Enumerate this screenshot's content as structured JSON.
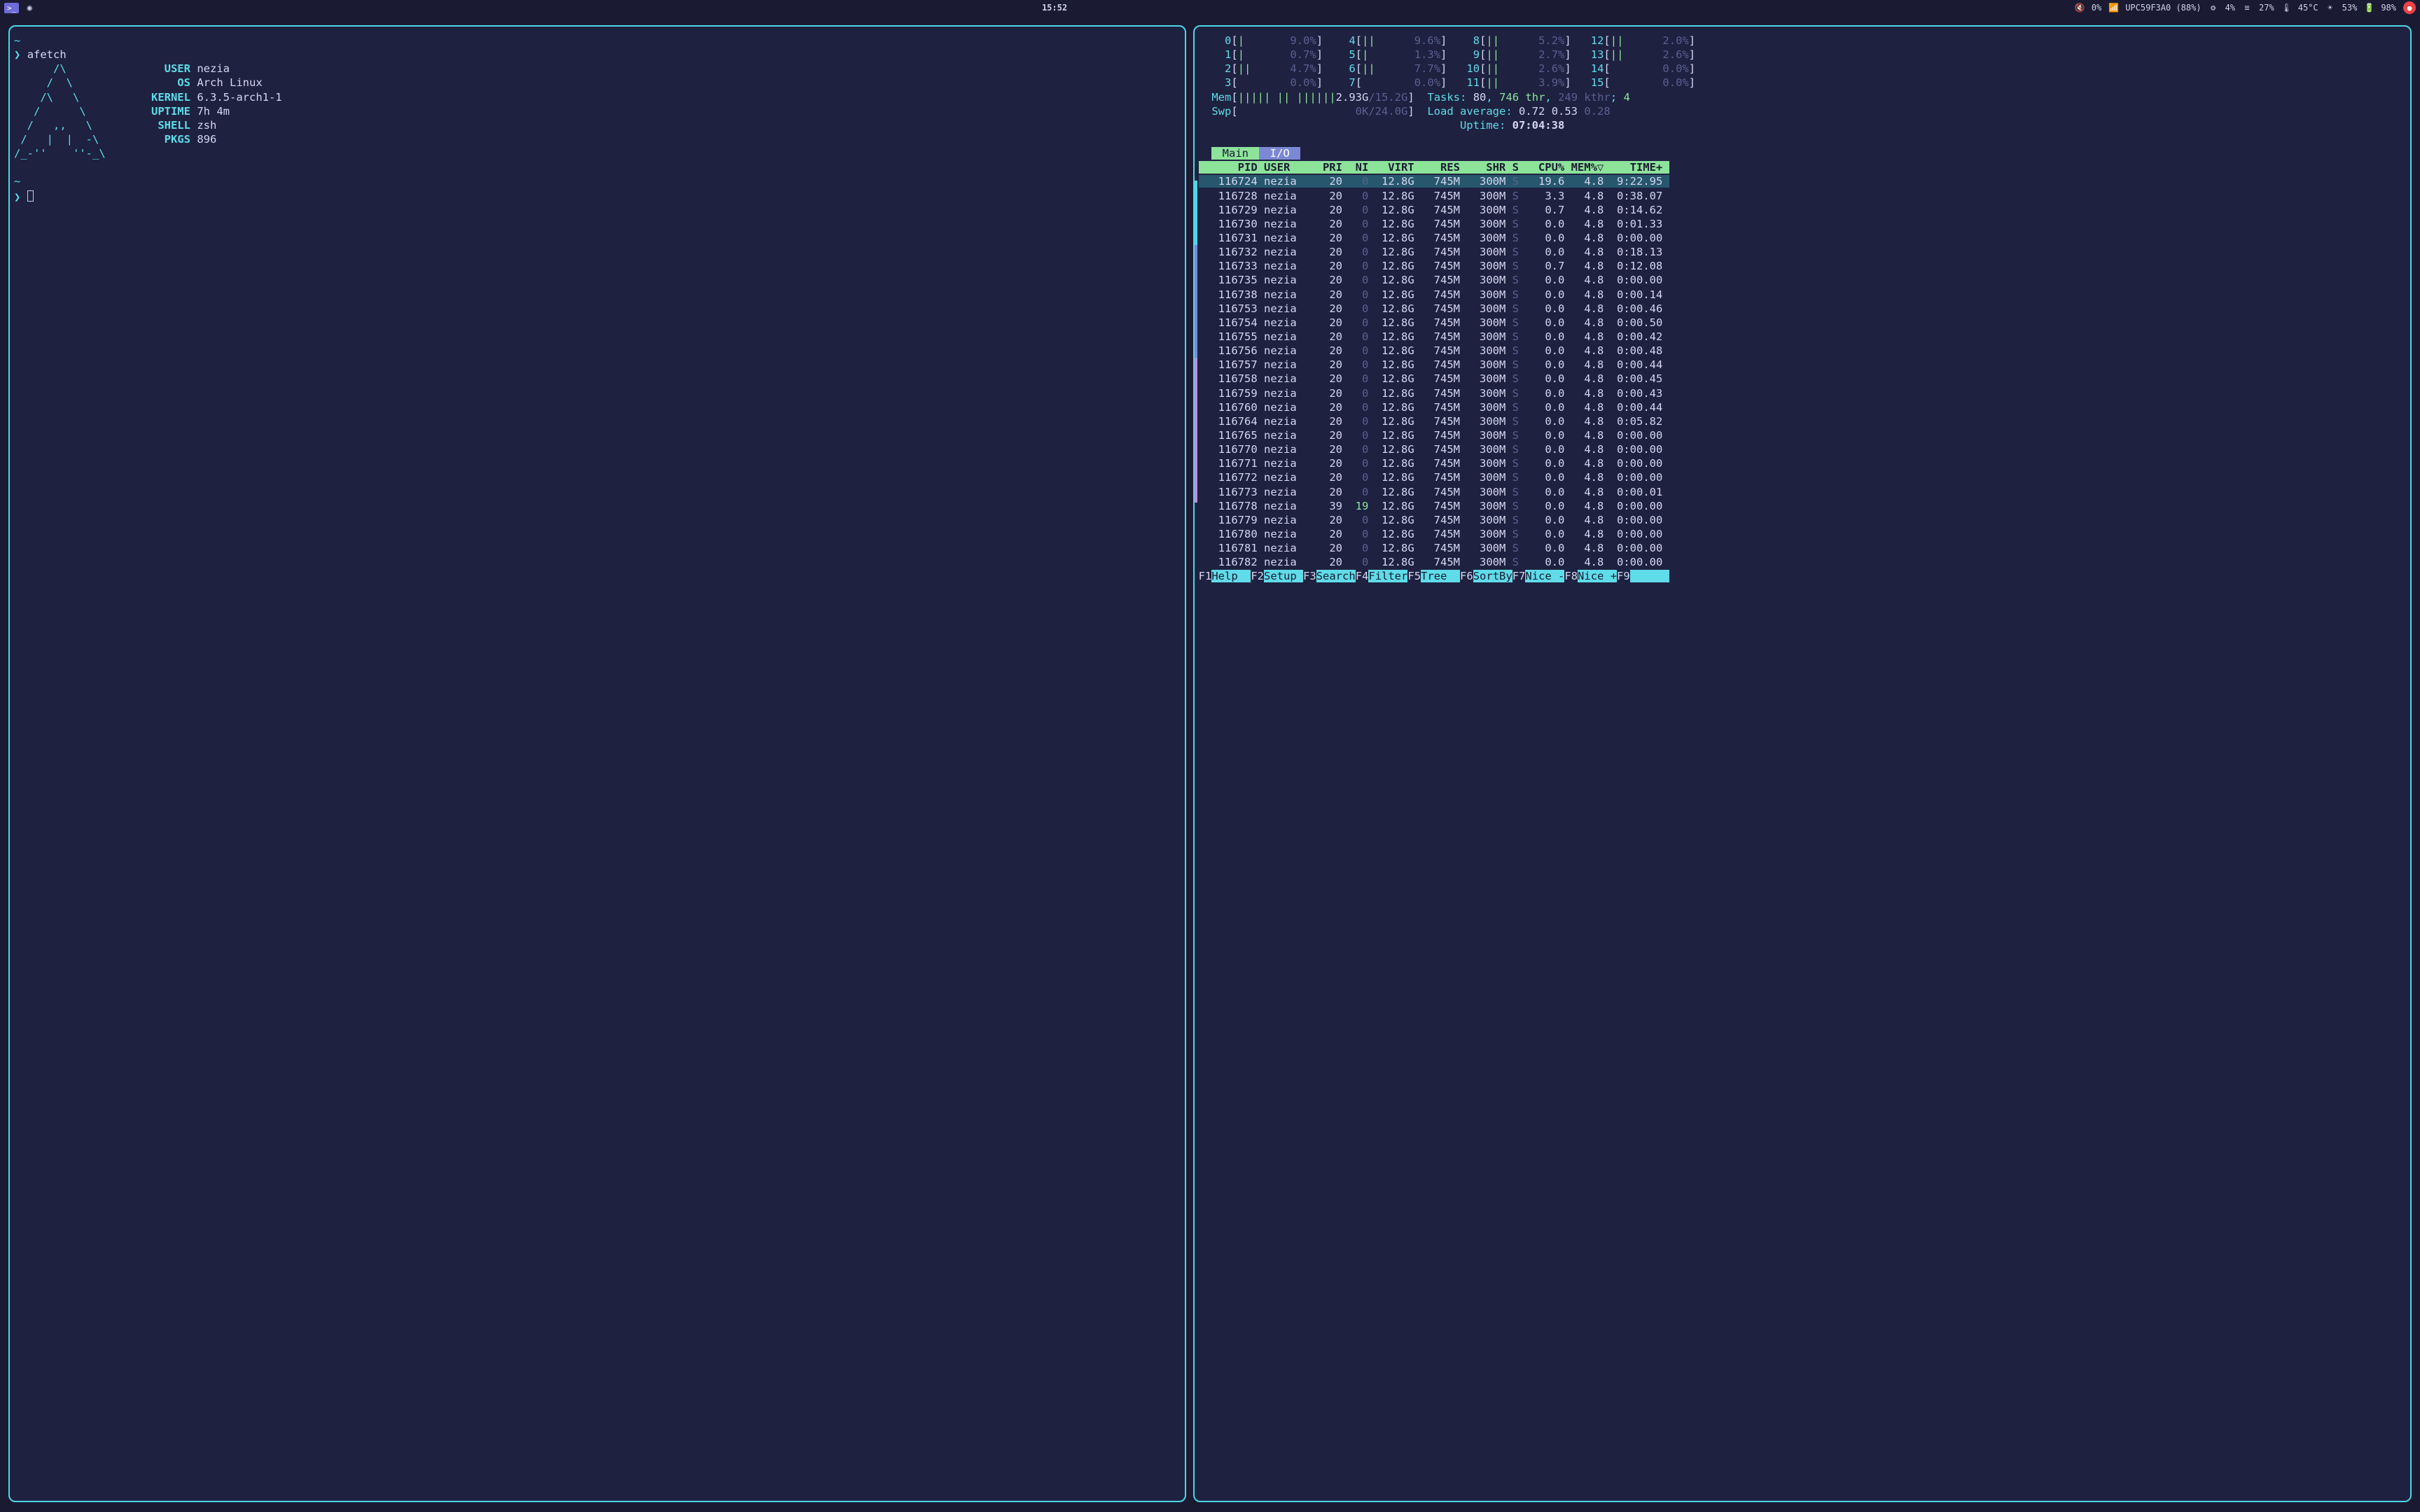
{
  "topbar": {
    "time": "15:52",
    "vol_pct": "0%",
    "wifi": "UPC59F3A0 (88%)",
    "gear_pct": "4%",
    "lines_pct": "27%",
    "temp": "45°C",
    "sun_pct": "53%",
    "bat_pct": "98%"
  },
  "afetch": {
    "prompt_cmd": "afetch",
    "ascii": [
      "      /\\",
      "     /  \\",
      "    /\\   \\",
      "   /      \\",
      "  /   ,,   \\",
      " /   |  |  -\\",
      "/_-''    ''-_\\"
    ],
    "labels": {
      "user": "USER",
      "os": "OS",
      "kernel": "KERNEL",
      "uptime": "UPTIME",
      "shell": "SHELL",
      "pkgs": "PKGS"
    },
    "vals": {
      "user": "nezia",
      "os": "Arch Linux",
      "kernel": "6.3.5-arch1-1",
      "uptime": "7h 4m",
      "shell": "zsh",
      "pkgs": "896"
    }
  },
  "htop": {
    "cpus": [
      {
        "n": "0",
        "bar": "|",
        "pct": "9.0%"
      },
      {
        "n": "1",
        "bar": "|",
        "pct": "0.7%"
      },
      {
        "n": "2",
        "bar": "||",
        "pct": "4.7%"
      },
      {
        "n": "3",
        "bar": "",
        "pct": "0.0%"
      },
      {
        "n": "4",
        "bar": "||",
        "pct": "9.6%"
      },
      {
        "n": "5",
        "bar": "|",
        "pct": "1.3%"
      },
      {
        "n": "6",
        "bar": "||",
        "pct": "7.7%"
      },
      {
        "n": "7",
        "bar": "",
        "pct": "0.0%"
      },
      {
        "n": "8",
        "bar": "||",
        "pct": "5.2%"
      },
      {
        "n": "9",
        "bar": "||",
        "pct": "2.7%"
      },
      {
        "n": "10",
        "bar": "||",
        "pct": "2.6%"
      },
      {
        "n": "11",
        "bar": "||",
        "pct": "3.9%"
      },
      {
        "n": "12",
        "bar": "||",
        "pct": "2.0%"
      },
      {
        "n": "13",
        "bar": "||",
        "pct": "2.6%"
      },
      {
        "n": "14",
        "bar": "",
        "pct": "0.0%"
      },
      {
        "n": "15",
        "bar": "",
        "pct": "0.0%"
      }
    ],
    "mem_label": "Mem",
    "mem_bar": "||||| || ||||||",
    "mem_used": "2.93G",
    "mem_total": "15.2G",
    "swp_label": "Swp",
    "swp_used": "0K",
    "swp_total": "24.0G",
    "tasks_label": "Tasks:",
    "tasks_procs": "80",
    "tasks_thr": "746",
    "tasks_thr_lbl": "thr",
    "tasks_kthr": "249",
    "tasks_kthr_lbl": "kthr",
    "tasks_running": "4",
    "load_label": "Load average:",
    "load": [
      "0.72",
      "0.53",
      "0.28"
    ],
    "uptime_label": "Uptime:",
    "uptime": "07:04:38",
    "tab_main": "Main",
    "tab_io": "I/O",
    "cols": [
      "PID",
      "USER",
      "PRI",
      "NI",
      "VIRT",
      "RES",
      "SHR",
      "S",
      "CPU%",
      "MEM%▽",
      "TIME+"
    ],
    "rows": [
      {
        "pid": "116724",
        "user": "nezia",
        "pri": "20",
        "ni": "0",
        "virt": "12.8G",
        "res": "745M",
        "shr": "300M",
        "s": "S",
        "cpu": "19.6",
        "mem": "4.8",
        "time": "9:22.95",
        "sel": true
      },
      {
        "pid": "116728",
        "user": "nezia",
        "pri": "20",
        "ni": "0",
        "virt": "12.8G",
        "res": "745M",
        "shr": "300M",
        "s": "S",
        "cpu": "3.3",
        "mem": "4.8",
        "time": "0:38.07"
      },
      {
        "pid": "116729",
        "user": "nezia",
        "pri": "20",
        "ni": "0",
        "virt": "12.8G",
        "res": "745M",
        "shr": "300M",
        "s": "S",
        "cpu": "0.7",
        "mem": "4.8",
        "time": "0:14.62"
      },
      {
        "pid": "116730",
        "user": "nezia",
        "pri": "20",
        "ni": "0",
        "virt": "12.8G",
        "res": "745M",
        "shr": "300M",
        "s": "S",
        "cpu": "0.0",
        "mem": "4.8",
        "time": "0:01.33"
      },
      {
        "pid": "116731",
        "user": "nezia",
        "pri": "20",
        "ni": "0",
        "virt": "12.8G",
        "res": "745M",
        "shr": "300M",
        "s": "S",
        "cpu": "0.0",
        "mem": "4.8",
        "time": "0:00.00"
      },
      {
        "pid": "116732",
        "user": "nezia",
        "pri": "20",
        "ni": "0",
        "virt": "12.8G",
        "res": "745M",
        "shr": "300M",
        "s": "S",
        "cpu": "0.0",
        "mem": "4.8",
        "time": "0:18.13"
      },
      {
        "pid": "116733",
        "user": "nezia",
        "pri": "20",
        "ni": "0",
        "virt": "12.8G",
        "res": "745M",
        "shr": "300M",
        "s": "S",
        "cpu": "0.7",
        "mem": "4.8",
        "time": "0:12.08"
      },
      {
        "pid": "116735",
        "user": "nezia",
        "pri": "20",
        "ni": "0",
        "virt": "12.8G",
        "res": "745M",
        "shr": "300M",
        "s": "S",
        "cpu": "0.0",
        "mem": "4.8",
        "time": "0:00.00"
      },
      {
        "pid": "116738",
        "user": "nezia",
        "pri": "20",
        "ni": "0",
        "virt": "12.8G",
        "res": "745M",
        "shr": "300M",
        "s": "S",
        "cpu": "0.0",
        "mem": "4.8",
        "time": "0:00.14"
      },
      {
        "pid": "116753",
        "user": "nezia",
        "pri": "20",
        "ni": "0",
        "virt": "12.8G",
        "res": "745M",
        "shr": "300M",
        "s": "S",
        "cpu": "0.0",
        "mem": "4.8",
        "time": "0:00.46"
      },
      {
        "pid": "116754",
        "user": "nezia",
        "pri": "20",
        "ni": "0",
        "virt": "12.8G",
        "res": "745M",
        "shr": "300M",
        "s": "S",
        "cpu": "0.0",
        "mem": "4.8",
        "time": "0:00.50"
      },
      {
        "pid": "116755",
        "user": "nezia",
        "pri": "20",
        "ni": "0",
        "virt": "12.8G",
        "res": "745M",
        "shr": "300M",
        "s": "S",
        "cpu": "0.0",
        "mem": "4.8",
        "time": "0:00.42"
      },
      {
        "pid": "116756",
        "user": "nezia",
        "pri": "20",
        "ni": "0",
        "virt": "12.8G",
        "res": "745M",
        "shr": "300M",
        "s": "S",
        "cpu": "0.0",
        "mem": "4.8",
        "time": "0:00.48"
      },
      {
        "pid": "116757",
        "user": "nezia",
        "pri": "20",
        "ni": "0",
        "virt": "12.8G",
        "res": "745M",
        "shr": "300M",
        "s": "S",
        "cpu": "0.0",
        "mem": "4.8",
        "time": "0:00.44"
      },
      {
        "pid": "116758",
        "user": "nezia",
        "pri": "20",
        "ni": "0",
        "virt": "12.8G",
        "res": "745M",
        "shr": "300M",
        "s": "S",
        "cpu": "0.0",
        "mem": "4.8",
        "time": "0:00.45"
      },
      {
        "pid": "116759",
        "user": "nezia",
        "pri": "20",
        "ni": "0",
        "virt": "12.8G",
        "res": "745M",
        "shr": "300M",
        "s": "S",
        "cpu": "0.0",
        "mem": "4.8",
        "time": "0:00.43"
      },
      {
        "pid": "116760",
        "user": "nezia",
        "pri": "20",
        "ni": "0",
        "virt": "12.8G",
        "res": "745M",
        "shr": "300M",
        "s": "S",
        "cpu": "0.0",
        "mem": "4.8",
        "time": "0:00.44"
      },
      {
        "pid": "116764",
        "user": "nezia",
        "pri": "20",
        "ni": "0",
        "virt": "12.8G",
        "res": "745M",
        "shr": "300M",
        "s": "S",
        "cpu": "0.0",
        "mem": "4.8",
        "time": "0:05.82"
      },
      {
        "pid": "116765",
        "user": "nezia",
        "pri": "20",
        "ni": "0",
        "virt": "12.8G",
        "res": "745M",
        "shr": "300M",
        "s": "S",
        "cpu": "0.0",
        "mem": "4.8",
        "time": "0:00.00"
      },
      {
        "pid": "116770",
        "user": "nezia",
        "pri": "20",
        "ni": "0",
        "virt": "12.8G",
        "res": "745M",
        "shr": "300M",
        "s": "S",
        "cpu": "0.0",
        "mem": "4.8",
        "time": "0:00.00"
      },
      {
        "pid": "116771",
        "user": "nezia",
        "pri": "20",
        "ni": "0",
        "virt": "12.8G",
        "res": "745M",
        "shr": "300M",
        "s": "S",
        "cpu": "0.0",
        "mem": "4.8",
        "time": "0:00.00"
      },
      {
        "pid": "116772",
        "user": "nezia",
        "pri": "20",
        "ni": "0",
        "virt": "12.8G",
        "res": "745M",
        "shr": "300M",
        "s": "S",
        "cpu": "0.0",
        "mem": "4.8",
        "time": "0:00.00"
      },
      {
        "pid": "116773",
        "user": "nezia",
        "pri": "20",
        "ni": "0",
        "virt": "12.8G",
        "res": "745M",
        "shr": "300M",
        "s": "S",
        "cpu": "0.0",
        "mem": "4.8",
        "time": "0:00.01"
      },
      {
        "pid": "116778",
        "user": "nezia",
        "pri": "39",
        "ni": "19",
        "virt": "12.8G",
        "res": "745M",
        "shr": "300M",
        "s": "S",
        "cpu": "0.0",
        "mem": "4.8",
        "time": "0:00.00"
      },
      {
        "pid": "116779",
        "user": "nezia",
        "pri": "20",
        "ni": "0",
        "virt": "12.8G",
        "res": "745M",
        "shr": "300M",
        "s": "S",
        "cpu": "0.0",
        "mem": "4.8",
        "time": "0:00.00"
      },
      {
        "pid": "116780",
        "user": "nezia",
        "pri": "20",
        "ni": "0",
        "virt": "12.8G",
        "res": "745M",
        "shr": "300M",
        "s": "S",
        "cpu": "0.0",
        "mem": "4.8",
        "time": "0:00.00"
      },
      {
        "pid": "116781",
        "user": "nezia",
        "pri": "20",
        "ni": "0",
        "virt": "12.8G",
        "res": "745M",
        "shr": "300M",
        "s": "S",
        "cpu": "0.0",
        "mem": "4.8",
        "time": "0:00.00"
      },
      {
        "pid": "116782",
        "user": "nezia",
        "pri": "20",
        "ni": "0",
        "virt": "12.8G",
        "res": "745M",
        "shr": "300M",
        "s": "S",
        "cpu": "0.0",
        "mem": "4.8",
        "time": "0:00.00"
      }
    ],
    "fns": [
      {
        "k": "F1",
        "l": "Help"
      },
      {
        "k": "F2",
        "l": "Setup"
      },
      {
        "k": "F3",
        "l": "Search"
      },
      {
        "k": "F4",
        "l": "Filter"
      },
      {
        "k": "F5",
        "l": "Tree"
      },
      {
        "k": "F6",
        "l": "SortBy"
      },
      {
        "k": "F7",
        "l": "Nice -"
      },
      {
        "k": "F8",
        "l": "Nice +"
      },
      {
        "k": "F9",
        "l": ""
      }
    ]
  }
}
